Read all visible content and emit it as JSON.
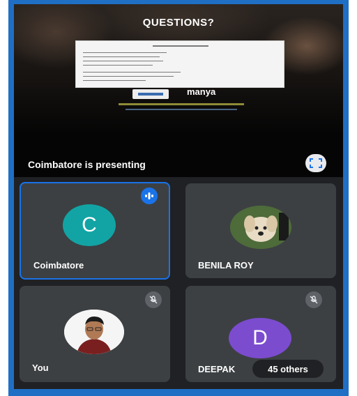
{
  "presentation": {
    "slide_title": "QUESTIONS?",
    "slide_brand": "manya",
    "presenting_label": "Coimbatore is presenting"
  },
  "participants": [
    {
      "name": "Coimbatore",
      "initial": "C",
      "avatar_color": "#12a4a4",
      "status": "speaking"
    },
    {
      "name": "BENILA ROY",
      "status": "none"
    },
    {
      "name": "You",
      "status": "muted"
    },
    {
      "name": "DEEPAK",
      "initial": "D",
      "avatar_color": "#7c4ccf",
      "status": "muted"
    }
  ],
  "others_label": "45 others",
  "colors": {
    "accent": "#1a73e8",
    "tile_bg": "#3c4043",
    "background": "#202124"
  }
}
